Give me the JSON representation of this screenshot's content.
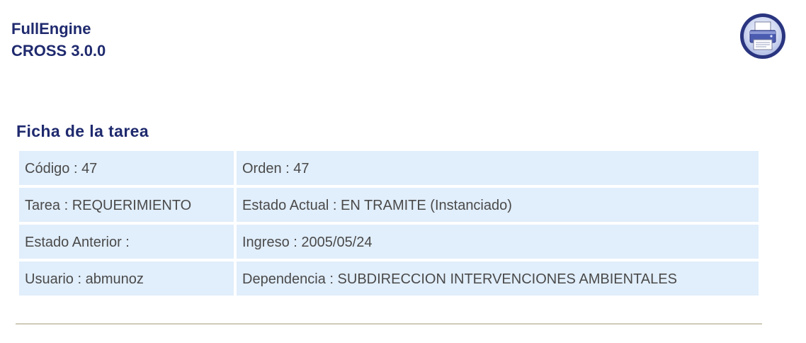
{
  "header": {
    "app_name": "FullEngine",
    "app_version": "CROSS 3.0.0",
    "print_icon": "printer-icon"
  },
  "task_card": {
    "title": "Ficha de la tarea",
    "rows": [
      {
        "left": {
          "label": "Código",
          "value": "47"
        },
        "right": {
          "label": "Orden",
          "value": "47"
        }
      },
      {
        "left": {
          "label": "Tarea",
          "value": "REQUERIMIENTO"
        },
        "right": {
          "label": "Estado Actual",
          "value": "EN TRAMITE (Instanciado)"
        }
      },
      {
        "left": {
          "label": "Estado Anterior",
          "value": ""
        },
        "right": {
          "label": "Ingreso",
          "value": "2005/05/24"
        }
      },
      {
        "left": {
          "label": "Usuario",
          "value": "abmunoz"
        },
        "right": {
          "label": "Dependencia",
          "value": "SUBDIRECCION INTERVENCIONES AMBIENTALES"
        }
      }
    ]
  },
  "colors": {
    "heading": "#1f2a6e",
    "cell_background": "#e1eefb",
    "body_text": "#4a4a4a",
    "rule": "#cfcbb8"
  }
}
